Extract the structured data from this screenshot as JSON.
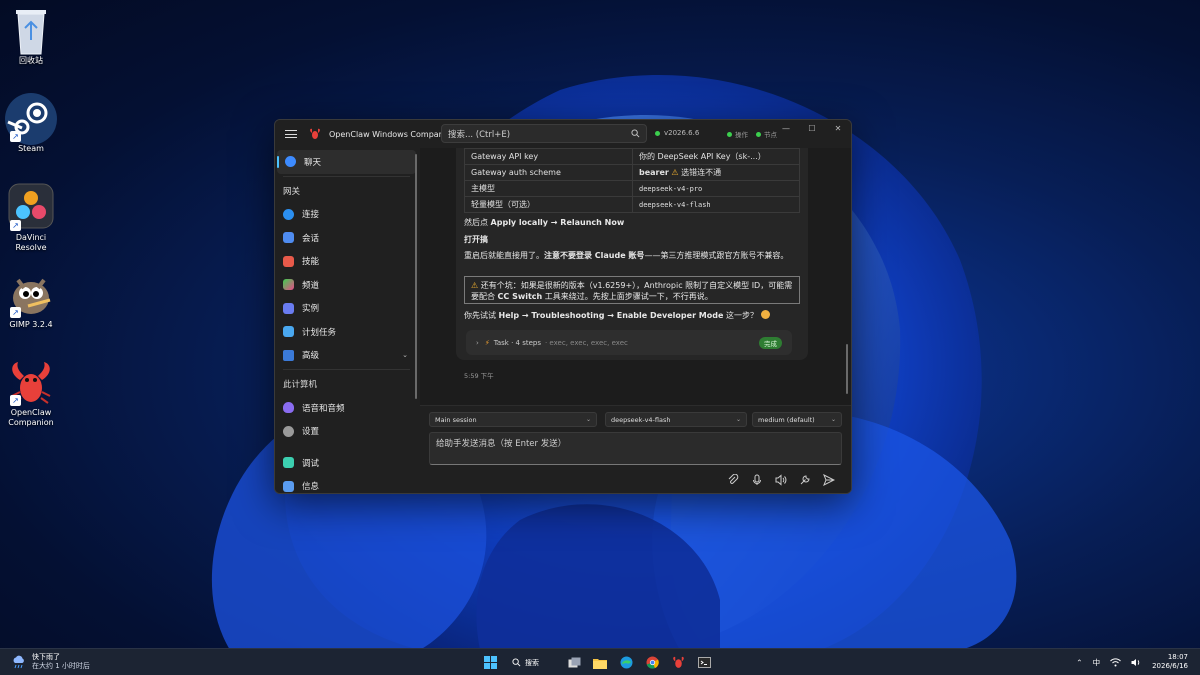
{
  "desktop": {
    "icons": [
      {
        "label": "回收站"
      },
      {
        "label": "Steam"
      },
      {
        "label": "DaVinci Resolve"
      },
      {
        "label": "GIMP 3.2.4"
      },
      {
        "label": "OpenClaw Companion"
      }
    ]
  },
  "window": {
    "title": "OpenClaw Windows Companion",
    "search_placeholder": "搜索... (Ctrl+E)",
    "version": "v2026.6.6",
    "status_ops": "操作",
    "status_nodes": "节点"
  },
  "sidebar": {
    "chat": "聊天",
    "gateway_heading": "网关",
    "items": [
      "连接",
      "会话",
      "技能",
      "频道",
      "实例",
      "计划任务",
      "高级"
    ],
    "pc_heading": "此计算机",
    "pc_items": [
      "语音和音频",
      "设置"
    ],
    "bottom_items": [
      "调试",
      "信息"
    ]
  },
  "chat": {
    "table": [
      {
        "k": "Gateway API key",
        "v": "你的 DeepSeek API Key（sk-...）"
      },
      {
        "k": "Gateway auth scheme",
        "v_bold": "bearer",
        "v_rest": "选错连不通"
      },
      {
        "k": "主模型",
        "v": "deepseek-v4-pro"
      },
      {
        "k": "轻量模型（可选）",
        "v": "deepseek-v4-flash"
      }
    ],
    "then_prefix": "然后点 ",
    "then_bold": "Apply locally → Relaunch Now",
    "heading": "打开搞",
    "restart_prefix": "重启后就能直接用了。",
    "restart_bold1": "注意不要登录 Claude 账号",
    "restart_suffix": "——第三方推理模式跟官方账号不兼容。",
    "warn_line1": "还有个坑：如果是很新的版本（v1.6259+），Anthropic 限制了自定义模型 ID，可能需",
    "warn_line2_prefix": "要配合 ",
    "warn_line2_bold": "CC Switch",
    "warn_line2_suffix": " 工具来绕过。先按上面步骤试一下，不行再说。",
    "ask_prefix": "你先试试 ",
    "ask_bold": "Help → Troubleshooting → Enable Developer Mode",
    "ask_suffix": " 这一步？",
    "task_label": "Task · 4 steps",
    "task_sub": "· exec, exec, exec, exec",
    "task_badge": "完成",
    "timestamp": "5:59 下午"
  },
  "composer": {
    "session": "Main session",
    "model": "deepseek-v4-flash",
    "effort": "medium (default)",
    "placeholder": "给助手发送消息（按 Enter 发送）"
  },
  "taskbar": {
    "weather_title": "快下雨了",
    "weather_sub": "在大约 1 小时时后",
    "search": "搜索",
    "ime": "中",
    "time": "18:07",
    "date": "2026/6/16"
  }
}
